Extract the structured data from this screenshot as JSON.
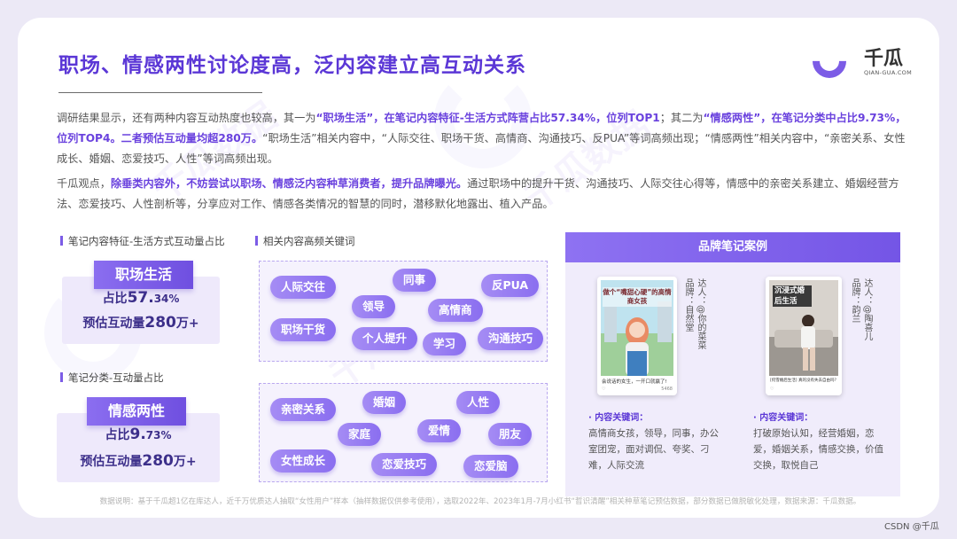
{
  "title": "职场、情感两性讨论度高，泛内容建立高互动关系",
  "logo": {
    "name": "千瓜",
    "sub": "QIAN-GUA.COM"
  },
  "paragraph1": {
    "s1": "调研结果显示，还有两种内容互动热度也较高，其一为",
    "h1": "“职场生活”，在笔记内容特征-生活方式阵营占比57.34%，位列TOP1",
    "s2": "；其二为",
    "h2": "“情感两性”，在笔记分类中占比9.73%，位列TOP4。二者预估互动量均超280万。",
    "s3": "“职场生活”相关内容中，“人际交往、职场干货、高情商、沟通技巧、反PUA”等词高频出现；“情感两性”相关内容中，“亲密关系、女性成长、婚姻、恋爱技巧、人性”等词高频出现。"
  },
  "paragraph2": {
    "s1": "千瓜观点，",
    "h1": "除垂类内容外，不妨尝试以职场、情感泛内容种草消费者，提升品牌曝光。",
    "s2": "通过职场中的提升干货、沟通技巧、人际交往心得等，情感中的亲密关系建立、婚姻经营方法、恋爱技巧、人性剖析等，分享应对工作、情感各类情况的智慧的同时，潜移默化地露出、植入产品。"
  },
  "section_labels": {
    "lifestyle": "笔记内容特征-生活方式互动量占比",
    "keywords": "相关内容高频关键词",
    "category": "笔记分类-互动量占比"
  },
  "stat1": {
    "title": "职场生活",
    "ratio_prefix": "占比",
    "ratio_big": "57.",
    "ratio_small": "34%",
    "est_prefix": "预估互动量",
    "est_big": "280",
    "est_small": "万+"
  },
  "stat2": {
    "title": "情感两性",
    "ratio_prefix": "占比",
    "ratio_big": "9.",
    "ratio_small": "73%",
    "est_prefix": "预估互动量",
    "est_big": "280",
    "est_small": "万+"
  },
  "keywords_work": [
    "人际交往",
    "同事",
    "反PUA",
    "领导",
    "高情商",
    "职场干货",
    "个人提升",
    "学习",
    "沟通技巧"
  ],
  "keywords_love": [
    "亲密关系",
    "婚姻",
    "人性",
    "家庭",
    "爱情",
    "朋友",
    "女性成长",
    "恋爱技巧",
    "恋爱脑"
  ],
  "case": {
    "header": "品牌笔记案例",
    "left": {
      "image_title": "做个“嘴甜心硬”的高情商女孩",
      "caption": "会说话的女生，一开口就赢了!",
      "likes": "5468",
      "author_label": "达人：@你的菜菜",
      "brand_label": "品牌：自然堂",
      "kw_label": "· 内容关键词：",
      "keywords": "高情商女孩，领导，同事，办公室团宠，面对调侃、夸奖、刁难，人际交流"
    },
    "right": {
      "image_title": "沉浸式婚后生活",
      "caption": "[何雪婚后生活] 真的没有失去自由吗？",
      "likes": "",
      "author_label": "达人：@陶喜儿",
      "brand_label": "品牌：韵兰",
      "kw_label": "· 内容关键词：",
      "keywords": "打破原始认知，经营婚姻，恋爱，婚姻关系，情感交换，价值交换，取悦自己"
    }
  },
  "footnote": "数据说明：基于千瓜超1亿在库达人，近千万优质达人抽取“女性用户”样本（抽样数据仅供参考使用），选取2022年、2023年1月-7月小红书“哲识清醒”相关种草笔记预估数据，部分数据已做脱敏化处理，数据来源：千瓜数据。",
  "csdn": "CSDN @千瓜",
  "colors": {
    "accent": "#6a42de",
    "pill": "#9a7ff2",
    "panel": "#f0ecfb"
  }
}
